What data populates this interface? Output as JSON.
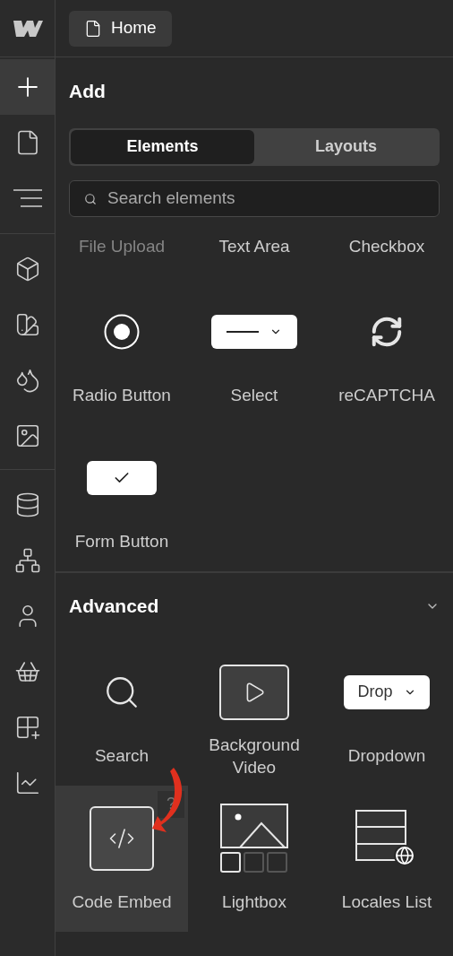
{
  "page_button": {
    "label": "Home"
  },
  "sidebar": {
    "groups": [
      [
        {
          "kind": "add",
          "selected": true
        },
        {
          "kind": "pages",
          "selected": false
        },
        {
          "kind": "navigator",
          "selected": false
        }
      ],
      [
        {
          "kind": "components",
          "selected": false
        },
        {
          "kind": "styles",
          "selected": false
        },
        {
          "kind": "variables",
          "selected": false
        },
        {
          "kind": "assets",
          "selected": false
        }
      ],
      [
        {
          "kind": "cms",
          "selected": false
        },
        {
          "kind": "logic",
          "selected": false
        },
        {
          "kind": "users",
          "selected": false
        },
        {
          "kind": "ecommerce",
          "selected": false
        },
        {
          "kind": "apps",
          "selected": false
        },
        {
          "kind": "insights",
          "selected": false
        }
      ]
    ]
  },
  "panel": {
    "title": "Add",
    "tabs": [
      {
        "label": "Elements",
        "selected": true
      },
      {
        "label": "Layouts",
        "selected": false
      }
    ],
    "search": {
      "placeholder": "Search elements"
    },
    "sections": [
      {
        "rows": [
          [
            {
              "label": "File Upload",
              "kind": "hidden",
              "dimmed": true,
              "selected": false
            },
            {
              "label": "Text Area",
              "kind": "hidden",
              "dimmed": false,
              "selected": false
            },
            {
              "label": "Checkbox",
              "kind": "hidden",
              "dimmed": false,
              "selected": false
            }
          ],
          [
            {
              "label": "Radio Button",
              "kind": "radio",
              "dimmed": false,
              "selected": false
            },
            {
              "label": "Select",
              "kind": "select",
              "dimmed": false,
              "selected": false
            },
            {
              "label": "reCAPTCHA",
              "kind": "recaptcha",
              "dimmed": false,
              "selected": false
            }
          ],
          [
            {
              "label": "Form Button",
              "kind": "form_button",
              "dimmed": false,
              "selected": false
            }
          ]
        ]
      },
      {
        "title": "Advanced",
        "expanded": true,
        "rows": [
          [
            {
              "label": "Search",
              "kind": "search",
              "dimmed": false,
              "selected": false
            },
            {
              "label": "Background Video",
              "kind": "video",
              "dimmed": false,
              "selected": false
            },
            {
              "label": "Dropdown",
              "kind": "dropdown",
              "preview": "Drop",
              "dimmed": false,
              "selected": false
            }
          ],
          [
            {
              "label": "Code Embed",
              "kind": "code",
              "help": "?",
              "annotated": true,
              "dimmed": false,
              "selected": true
            },
            {
              "label": "Lightbox",
              "kind": "lightbox",
              "dimmed": false,
              "selected": false
            },
            {
              "label": "Locales List",
              "kind": "locales",
              "dimmed": false,
              "selected": false
            }
          ]
        ]
      }
    ]
  }
}
